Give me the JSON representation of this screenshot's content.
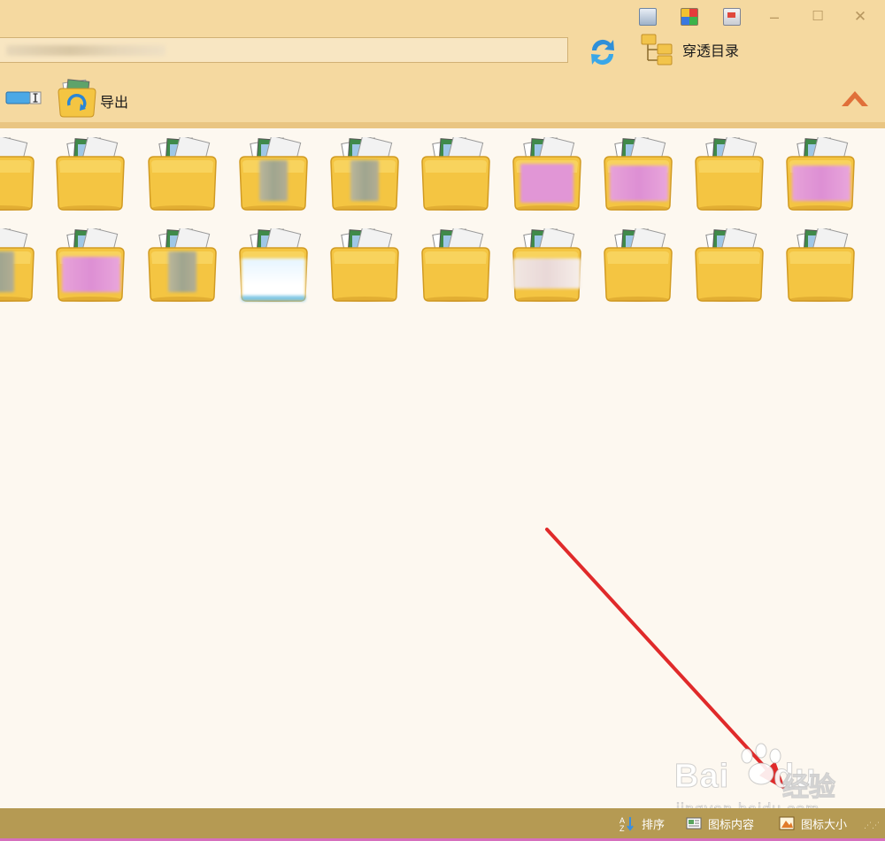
{
  "titlebar": {
    "icons": [
      "skin-icon",
      "color-palette-icon",
      "monitor-icon"
    ],
    "controls": {
      "minimize": "–",
      "maximize": "☐",
      "close": "✕"
    }
  },
  "address": {
    "value": ""
  },
  "toolbar": {
    "through_dir_label": "穿透目录",
    "export_label": "导出"
  },
  "folders": {
    "rows": [
      [
        "",
        "",
        "",
        "gray",
        "gray",
        "",
        "pink",
        "pinkfade",
        "",
        "pinkfade"
      ],
      [
        "gray",
        "pinkfade",
        "gray",
        "sky",
        "",
        "",
        "light",
        "",
        "",
        ""
      ]
    ]
  },
  "watermark": {
    "logo": "Bai",
    "logo_tail": "du",
    "text": "经验",
    "url": "jingyan.baidu.com"
  },
  "statusbar": {
    "sort_label": "排序",
    "icon_content_label": "图标内容",
    "icon_size_label": "图标大小"
  },
  "colors": {
    "chrome": "#f5d9a0",
    "content_bg": "#fdf8f0",
    "statusbar": "#b59a53",
    "arrow": "#e02a2a",
    "folder": "#f4c542"
  }
}
